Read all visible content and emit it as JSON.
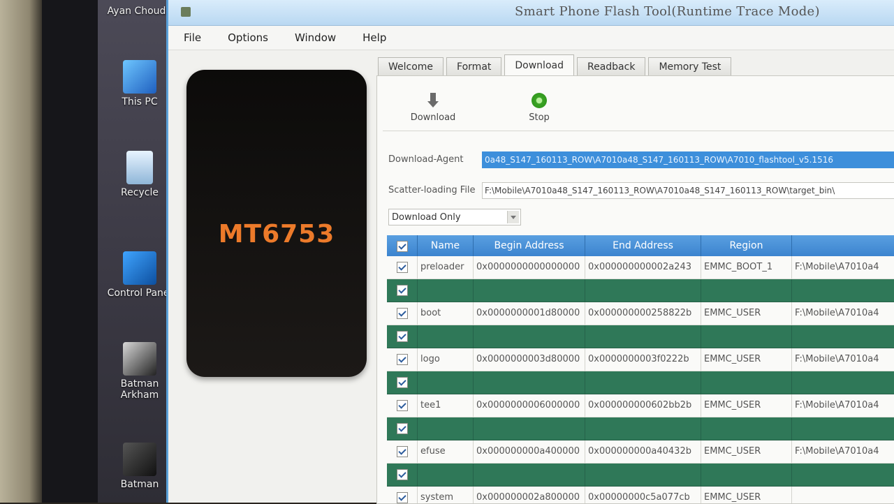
{
  "desktop": {
    "icons": [
      {
        "label": "Ayan Choudh",
        "icon": "user-folder-icon"
      },
      {
        "label": "This PC",
        "icon": "computer-icon"
      },
      {
        "label": "Recycle",
        "icon": "recycle-bin-icon"
      },
      {
        "label": "Control Panel",
        "icon": "control-panel-icon"
      },
      {
        "label": "Batman Arkham",
        "icon": "game-shortcut-icon"
      },
      {
        "label": "Batman",
        "icon": "game-shortcut-icon"
      }
    ]
  },
  "window": {
    "title": "Smart Phone Flash Tool(Runtime Trace Mode)"
  },
  "menu": [
    "File",
    "Options",
    "Window",
    "Help"
  ],
  "phone": {
    "chip": "MT6753"
  },
  "tabs": [
    {
      "label": "Welcome",
      "active": false
    },
    {
      "label": "Format",
      "active": false
    },
    {
      "label": "Download",
      "active": true
    },
    {
      "label": "Readback",
      "active": false
    },
    {
      "label": "Memory Test",
      "active": false
    }
  ],
  "toolbar": {
    "download_label": "Download",
    "stop_label": "Stop"
  },
  "fields": {
    "download_agent_label": "Download-Agent",
    "download_agent_value": "0a48_S147_160113_ROW\\A7010a48_S147_160113_ROW\\A7010_flashtool_v5.1516",
    "scatter_label": "Scatter-loading File",
    "scatter_value": "F:\\Mobile\\A7010a48_S147_160113_ROW\\A7010a48_S147_160113_ROW\\target_bin\\"
  },
  "mode_select": {
    "value": "Download Only"
  },
  "table": {
    "headers": [
      "Name",
      "Begin Address",
      "End Address",
      "Region",
      ""
    ],
    "rows": [
      {
        "name": "preloader",
        "begin": "0x0000000000000000",
        "end": "0x000000000002a243",
        "region": "EMMC_BOOT_1",
        "location": "F:\\Mobile\\A7010a4"
      },
      {
        "name": "",
        "begin": "",
        "end": "",
        "region": "",
        "location": ""
      },
      {
        "name": "boot",
        "begin": "0x0000000001d80000",
        "end": "0x000000000258822b",
        "region": "EMMC_USER",
        "location": "F:\\Mobile\\A7010a4"
      },
      {
        "name": "",
        "begin": "",
        "end": "",
        "region": "",
        "location": ""
      },
      {
        "name": "logo",
        "begin": "0x0000000003d80000",
        "end": "0x0000000003f0222b",
        "region": "EMMC_USER",
        "location": "F:\\Mobile\\A7010a4"
      },
      {
        "name": "",
        "begin": "",
        "end": "",
        "region": "",
        "location": ""
      },
      {
        "name": "tee1",
        "begin": "0x0000000006000000",
        "end": "0x000000000602bb2b",
        "region": "EMMC_USER",
        "location": "F:\\Mobile\\A7010a4"
      },
      {
        "name": "",
        "begin": "",
        "end": "",
        "region": "",
        "location": ""
      },
      {
        "name": "efuse",
        "begin": "0x000000000a400000",
        "end": "0x000000000a40432b",
        "region": "EMMC_USER",
        "location": "F:\\Mobile\\A7010a4"
      },
      {
        "name": "",
        "begin": "",
        "end": "",
        "region": "",
        "location": ""
      },
      {
        "name": "system",
        "begin": "0x000000002a800000",
        "end": "0x00000000c5a077cb",
        "region": "EMMC_USER",
        "location": ""
      }
    ]
  },
  "colors": {
    "header_blue": "#3c84cf",
    "blank_row_green": "#2f7858",
    "chip_orange": "#ec7a2a"
  }
}
